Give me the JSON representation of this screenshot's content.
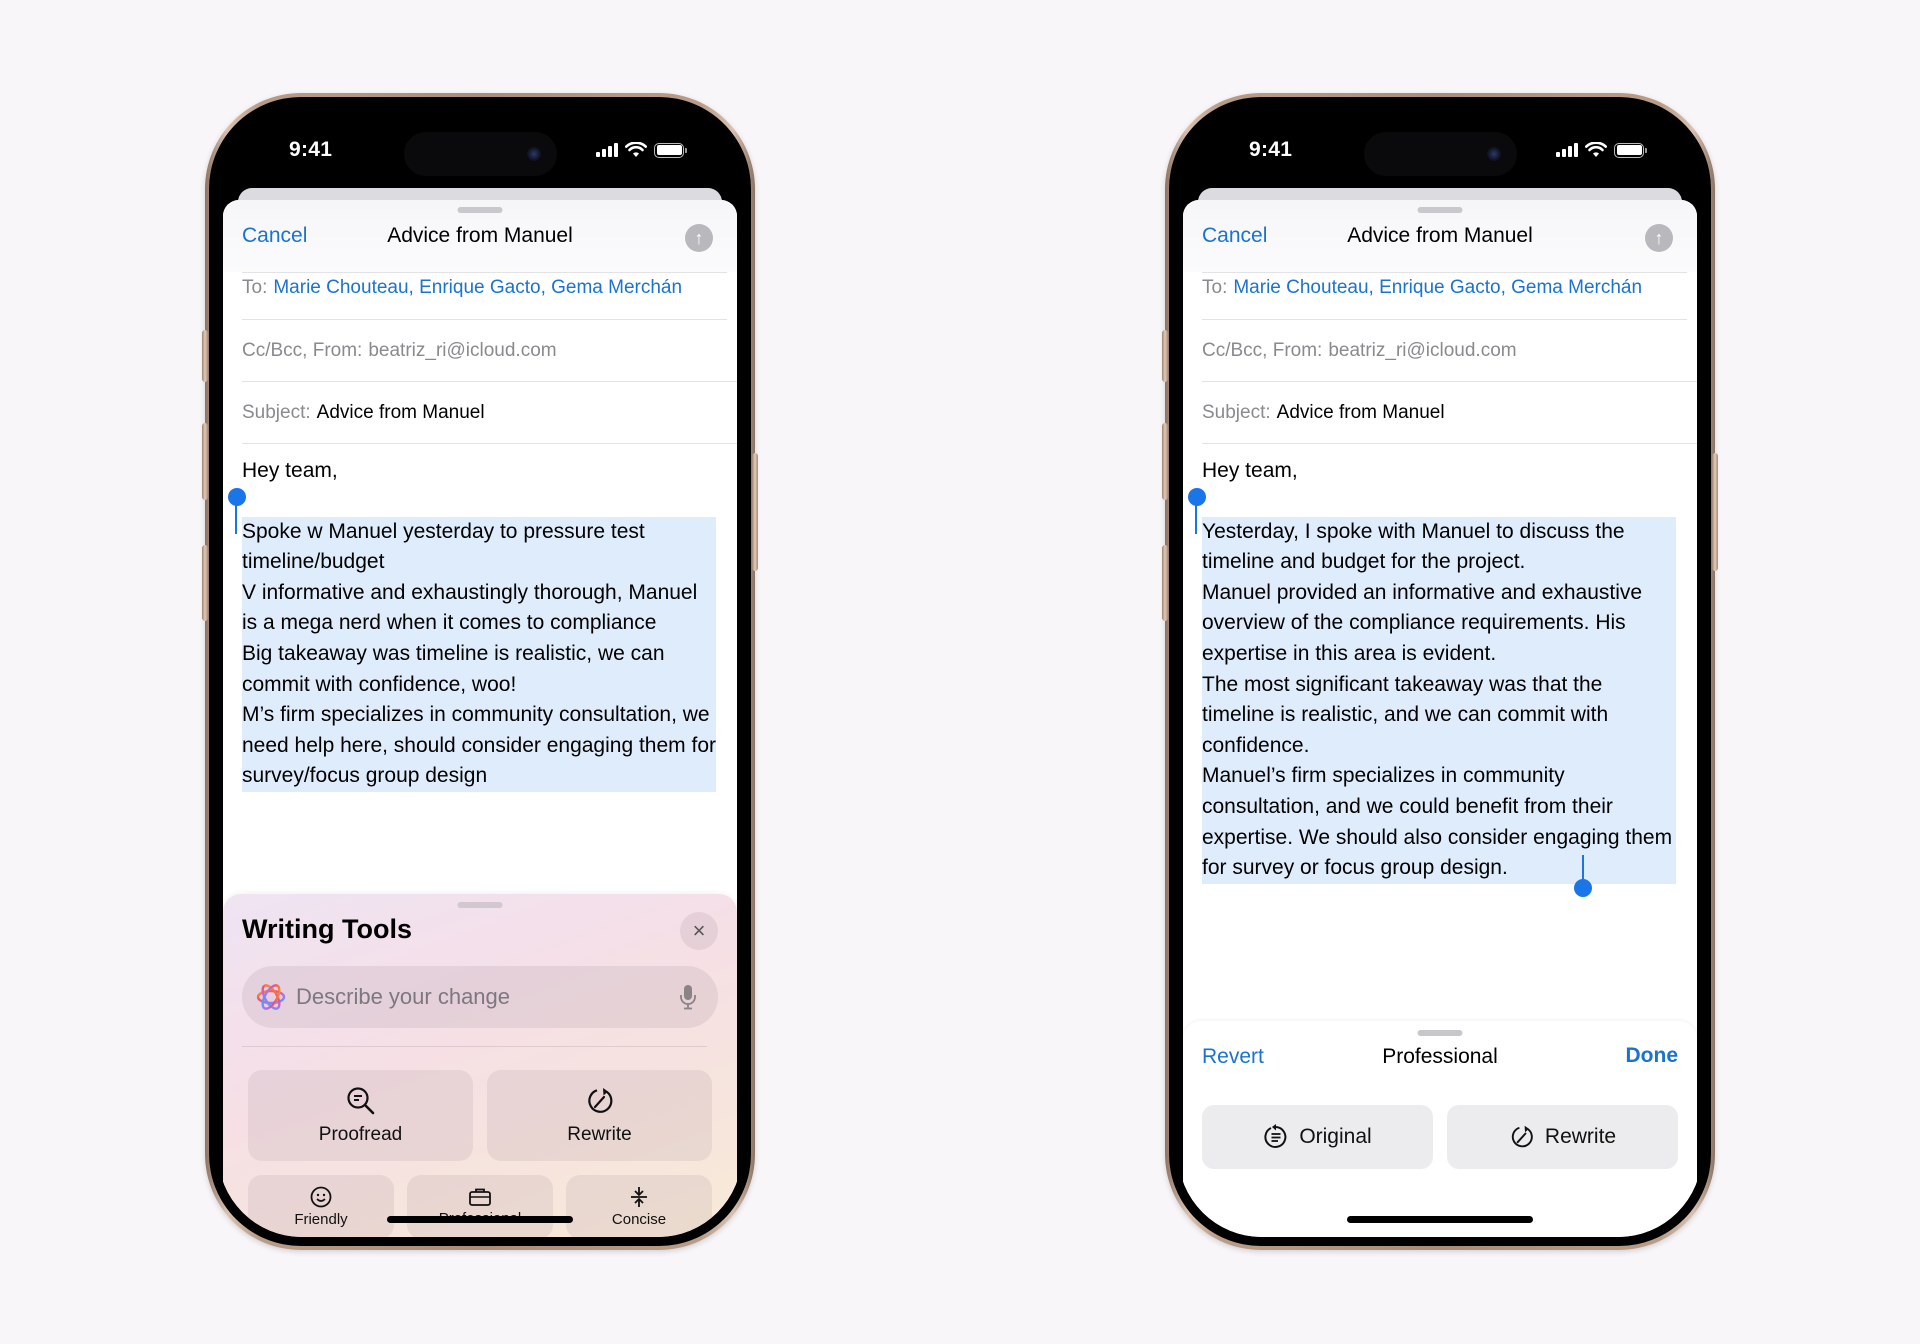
{
  "status_bar": {
    "time": "9:41"
  },
  "compose": {
    "cancel_label": "Cancel",
    "title": "Advice from Manuel",
    "to_label": "To:",
    "to_value": "Marie Chouteau, Enrique Gacto, Gema Merchán",
    "ccbcc_label": "Cc/Bcc, From:",
    "from_value": "beatriz_ri@icloud.com",
    "subject_label": "Subject:",
    "subject_value": "Advice from Manuel",
    "greeting": "Hey team,"
  },
  "left_phone": {
    "body_paragraphs": [
      "Spoke w Manuel yesterday to pressure test timeline/budget",
      "V informative and exhaustingly thorough, Manuel is a mega nerd when it comes to compliance",
      "Big takeaway was timeline is realistic, we can commit with confidence, woo!",
      "M’s firm specializes in community consultation, we need help here, should consider engaging them for survey/focus group design"
    ],
    "writing_tools": {
      "title": "Writing Tools",
      "close_label": "×",
      "input_placeholder": "Describe your change",
      "primary_actions": [
        {
          "label": "Proofread",
          "icon": "proofread-magnifier-icon"
        },
        {
          "label": "Rewrite",
          "icon": "rewrite-icon"
        }
      ],
      "tone_actions": [
        {
          "label": "Friendly",
          "icon": "smiley-icon"
        },
        {
          "label": "Professional",
          "icon": "briefcase-icon"
        },
        {
          "label": "Concise",
          "icon": "compress-icon"
        }
      ],
      "thumbnails": [
        {
          "icon": "summary-doc-icon",
          "arrow": "↓"
        },
        {
          "icon": "key-points-doc-icon",
          "arrow": "↓"
        },
        {
          "icon": "list-doc-icon",
          "arrow": "↓"
        },
        {
          "icon": "table-doc-icon",
          "arrow": "↓"
        }
      ]
    }
  },
  "right_phone": {
    "body_paragraphs": [
      "Yesterday, I spoke with Manuel to discuss the timeline and budget for the project.",
      "Manuel provided an informative and exhaustive overview of the compliance requirements. His expertise in this area is evident.",
      "The most significant takeaway was that the timeline is realistic, and we can commit with confidence.",
      "Manuel’s firm specializes in community consultation, and we could benefit from their expertise. We should also consider engaging them for survey or focus group design."
    ],
    "review_panel": {
      "revert_label": "Revert",
      "title": "Professional",
      "done_label": "Done",
      "original_label": "Original",
      "rewrite_label": "Rewrite"
    }
  },
  "colors": {
    "accent_blue": "#1a73d1",
    "selection_handle": "#1a76e8",
    "selection_bg": "#dfecfc",
    "frame_titanium": "#b89c88"
  }
}
